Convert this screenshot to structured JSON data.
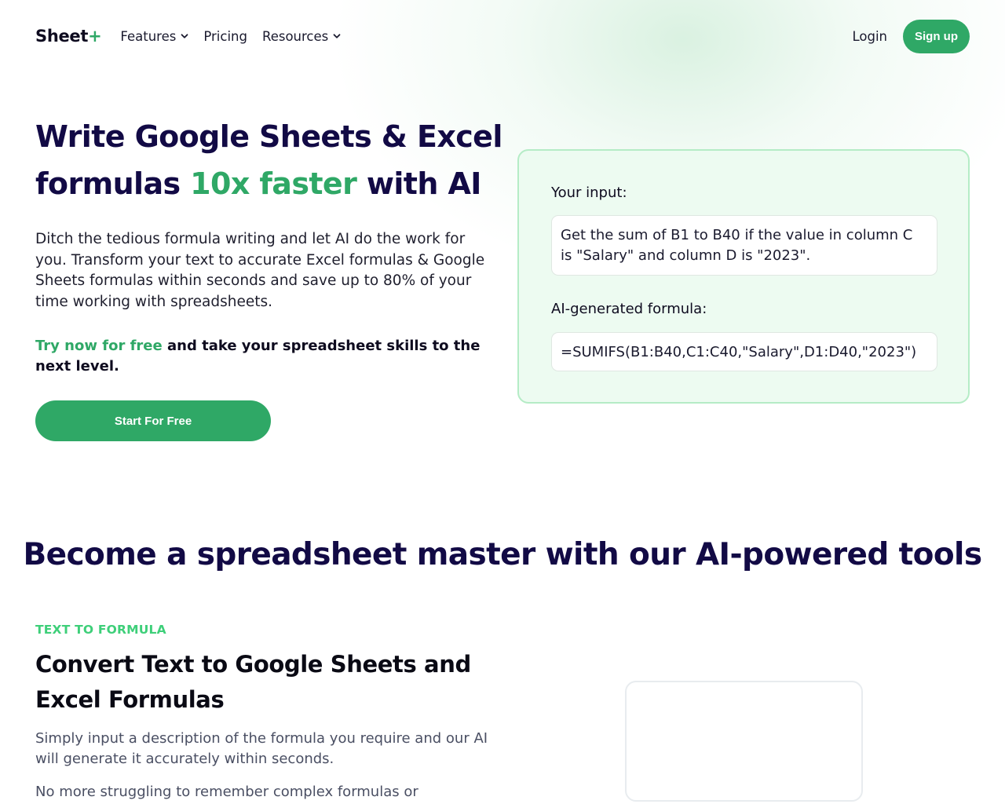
{
  "nav": {
    "logo_text": "Sheet",
    "logo_plus": "+",
    "features": "Features",
    "pricing": "Pricing",
    "resources": "Resources",
    "login": "Login",
    "signup": "Sign up"
  },
  "hero": {
    "title_line1": "Write Google Sheets & Excel",
    "title_pre": "formulas ",
    "title_accent": "10x faster",
    "title_post": " with AI",
    "description": "Ditch the tedious formula writing and let AI do the work for you. Transform your text to accurate Excel formulas & Google Sheets formulas within seconds and save up to 80% of your time working with spreadsheets.",
    "cta_accent": "Try now for free",
    "cta_rest": " and take your spreadsheet skills to the next level.",
    "start_button": "Start For Free"
  },
  "demo": {
    "input_label": "Your input:",
    "input_value": "Get the sum of B1 to B40 if the value in column C is \"Salary\" and column D is \"2023\".",
    "formula_label": "AI-generated formula:",
    "formula_value": "=SUMIFS(B1:B40,C1:C40,\"Salary\",D1:D40,\"2023\")"
  },
  "section": {
    "title": "Become a spreadsheet master with our AI-powered tools",
    "eyebrow": "TEXT TO FORMULA",
    "feature_title": "Convert Text to Google Sheets and Excel Formulas",
    "feature_p1": "Simply input a description of the formula you require and our AI will generate it accurately within seconds.",
    "feature_p2": "No more struggling to remember complex formulas or"
  },
  "colors": {
    "accent_green": "#2fa866",
    "heading_navy": "#120a45",
    "eyebrow_green": "#3ecf79",
    "card_bg": "#edfbf1"
  },
  "icons": {
    "features_dropdown": "chevron-down-icon",
    "resources_dropdown": "chevron-down-icon"
  }
}
